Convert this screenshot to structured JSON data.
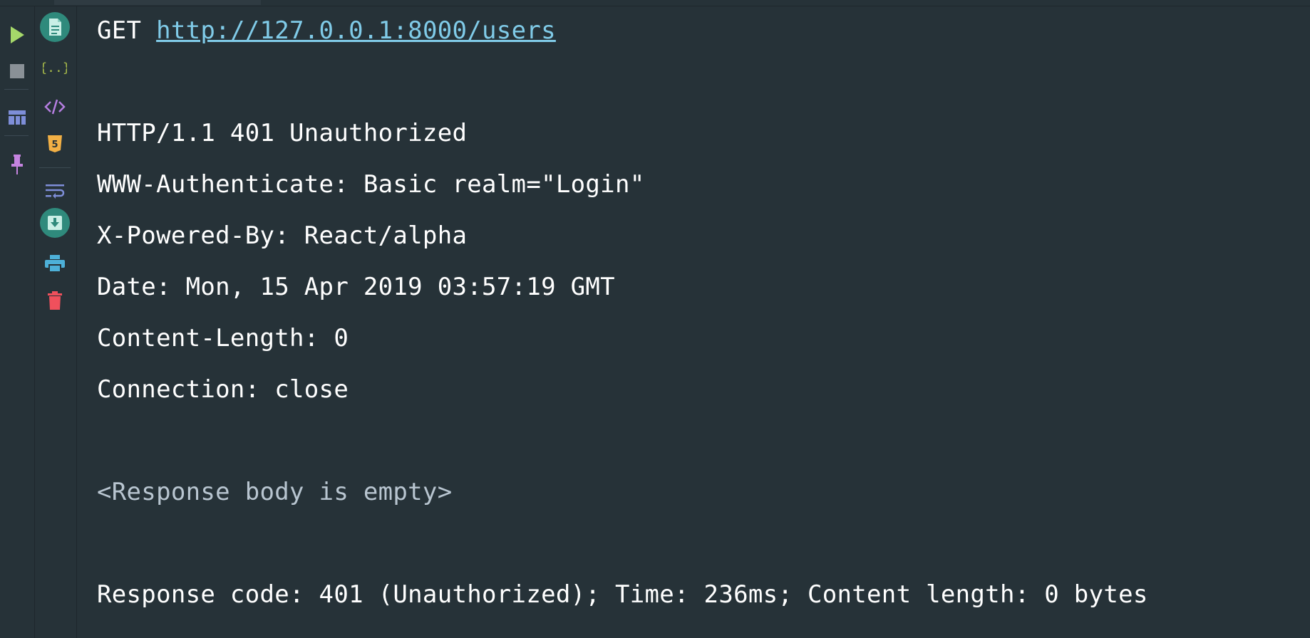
{
  "request": {
    "method": "GET",
    "url": "http://127.0.0.1:8000/users"
  },
  "response": {
    "status_line": "HTTP/1.1 401 Unauthorized",
    "headers": [
      "WWW-Authenticate: Basic realm=\"Login\"",
      "X-Powered-By: React/alpha",
      "Date: Mon, 15 Apr 2019 03:57:19 GMT",
      "Content-Length: 0",
      "Connection: close"
    ],
    "body_note": "<Response body is empty>",
    "summary": "Response code: 401 (Unauthorized); Time: 236ms; Content length: 0 bytes"
  },
  "toolbar_left": [
    {
      "name": "run-icon",
      "color": "#a5d86a"
    },
    {
      "name": "stop-icon",
      "color": "#8a9197"
    },
    {
      "name": "layout-icon",
      "color": "#7e8ed8"
    },
    {
      "name": "pin-icon",
      "color": "#c584e0"
    }
  ],
  "toolbar_right": [
    {
      "name": "text-view-icon",
      "color": "#2f8a7c"
    },
    {
      "name": "json-view-icon",
      "color": "#a5b84a"
    },
    {
      "name": "xml-view-icon",
      "color": "#b57ee0"
    },
    {
      "name": "html-view-icon",
      "color": "#f2b045"
    },
    {
      "name": "soft-wrap-icon",
      "color": "#7e8ed8"
    },
    {
      "name": "save-response-icon",
      "color": "#2f8a7c"
    },
    {
      "name": "print-icon",
      "color": "#4db0d8"
    },
    {
      "name": "delete-icon",
      "color": "#f0505c"
    }
  ]
}
